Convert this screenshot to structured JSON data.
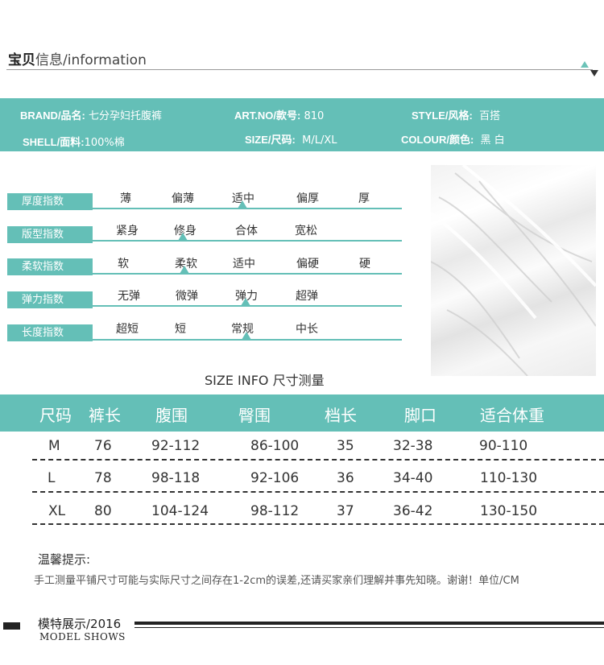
{
  "header": {
    "title_bold": "宝贝",
    "title_rest": "信息/information"
  },
  "info": {
    "brand": {
      "label": "BRAND/品名:",
      "value": "七分孕妇托腹裤"
    },
    "shell": {
      "label": "SHELL/面料:",
      "value": "100%棉"
    },
    "art": {
      "label": "ART.NO/款号:",
      "value": "810"
    },
    "size": {
      "label": "SIZE/尺码:",
      "value": "M/L/XL"
    },
    "style": {
      "label": "STYLE/风格:",
      "value": "百搭"
    },
    "colour": {
      "label": "COLOUR/颜色:",
      "value": "黑 白"
    },
    "accent_color": "#64bfb7"
  },
  "indices": [
    {
      "label": "厚度指数",
      "options": [
        "薄",
        "偏薄",
        "适中",
        "偏厚",
        "厚"
      ],
      "selected_index": 2
    },
    {
      "label": "版型指数",
      "options": [
        "紧身",
        "修身",
        "合体",
        "宽松"
      ],
      "selected_index": 1
    },
    {
      "label": "柔软指数",
      "options": [
        "软",
        "柔软",
        "适中",
        "偏硬",
        "硬"
      ],
      "selected_index": 1
    },
    {
      "label": "弹力指数",
      "options": [
        "无弹",
        "微弹",
        "弹力",
        "超弹"
      ],
      "selected_index": 2
    },
    {
      "label": "长度指数",
      "options": [
        "超短",
        "短",
        "常规",
        "中长"
      ],
      "selected_index": 2
    }
  ],
  "size_table": {
    "title": "SIZE INFO 尺寸测量",
    "headers": [
      "尺码",
      "裤长",
      "腹围",
      "臀围",
      "档长",
      "脚口",
      "适合体重"
    ],
    "rows": [
      [
        "M",
        "76",
        "92-112",
        "86-100",
        "35",
        "32-38",
        "90-110"
      ],
      [
        "L",
        "78",
        "98-118",
        "92-106",
        "36",
        "34-40",
        "110-130"
      ],
      [
        "XL",
        "80",
        "104-124",
        "98-112",
        "37",
        "36-42",
        "130-150"
      ]
    ]
  },
  "tips": {
    "title": "温馨提示:",
    "text": "手工测量平铺尺寸可能与实际尺寸之间存在1-2cm的误差,还请买家亲们理解并事先知晓。谢谢！单位/CM"
  },
  "footer": {
    "title": "模特展示/2016",
    "subtitle": "MODEL SHOWS"
  }
}
